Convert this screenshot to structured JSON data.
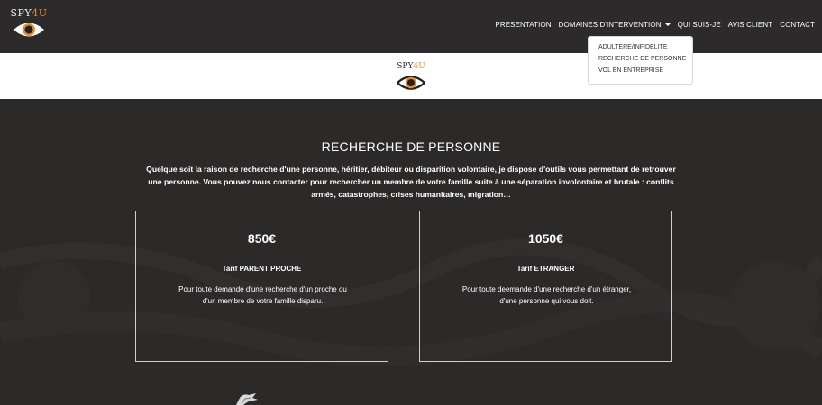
{
  "brand": {
    "text_main": "SPY",
    "text_accent": "4U"
  },
  "nav": {
    "items": [
      {
        "label": "PRESENTATION"
      },
      {
        "label": "DOMAINES D'INTERVENTION"
      },
      {
        "label": "QUI SUIS-JE"
      },
      {
        "label": "AVIS CLIENT"
      },
      {
        "label": "CONTACT"
      }
    ]
  },
  "dropdown": {
    "items": [
      {
        "label": "ADULTERE/INFIDELITE"
      },
      {
        "label": "RECHERCHE DE PERSONNE"
      },
      {
        "label": "VOL EN ENTREPRISE"
      }
    ]
  },
  "section": {
    "title": "RECHERCHE DE PERSONNE",
    "description": "Quelque soit la raison de recherche d'une personne, héritier, débiteur ou disparition volontaire, je dispose d'outils vous permettant de retrouver une personne. Vous pouvez nous contacter pour rechercher un membre de votre famille suite à une séparation involontaire et brutale : conflits armés, catastrophes, crises humanitaires, migration…"
  },
  "cards": [
    {
      "price": "850€",
      "tarif": "Tarif PARENT PROCHE",
      "text": "Pour toute demande d'une recherche d'un proche ou d'un membre de votre famille disparu."
    },
    {
      "price": "1050€",
      "tarif": "Tarif ETRANGER",
      "text": "Pour toute deemande d'une recherche d'un étranger, d'une personne qui vous doit."
    }
  ],
  "colors": {
    "accent": "#e88a2a",
    "dark": "#2e2b2b",
    "nav_bg": "#2c2a2a"
  },
  "icons": {
    "logo": "eye-logo-icon",
    "caret": "caret-down-icon",
    "hand": "hand-image-icon"
  }
}
